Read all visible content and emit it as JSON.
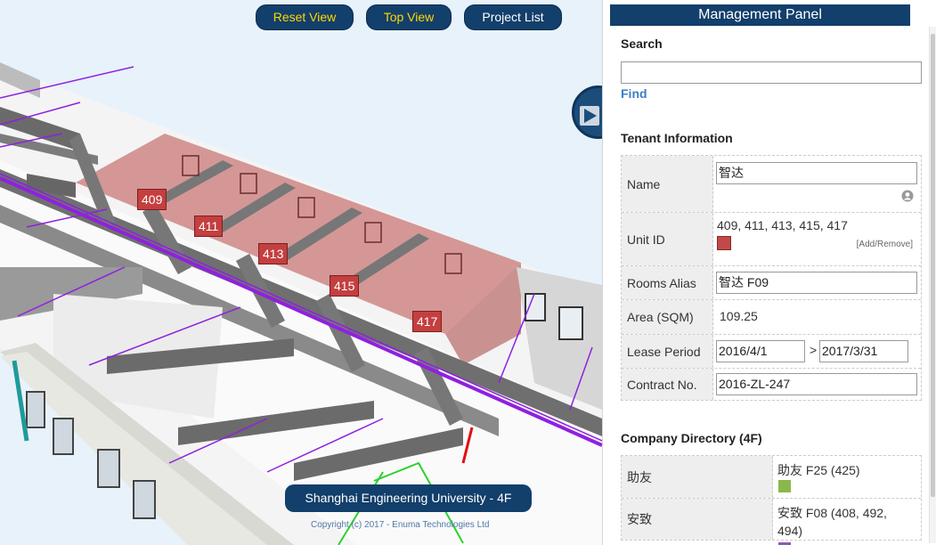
{
  "viewport": {
    "buttons": {
      "reset": "Reset View",
      "top": "Top View",
      "projects": "Project List"
    },
    "rooms": [
      "409",
      "411",
      "413",
      "415",
      "417"
    ],
    "caption": "Shanghai Engineering University - 4F",
    "copyright": "Copyright (c) 2017 - Enuma Technologies Ltd"
  },
  "panel": {
    "title": "Management Panel",
    "search": {
      "title": "Search",
      "value": "",
      "find_label": "Find"
    },
    "tenant": {
      "title": "Tenant Information",
      "name_label": "Name",
      "name_value": "智达",
      "unit_label": "Unit ID",
      "unit_value": "409, 411, 413, 415, 417",
      "unit_color": "#c04a4a",
      "add_remove": "[Add/Remove]",
      "alias_label": "Rooms Alias",
      "alias_value": "智达 F09",
      "area_label": "Area (SQM)",
      "area_value": "109.25",
      "lease_label": "Lease Period",
      "lease_start": "2016/4/1",
      "lease_sep": ">",
      "lease_end": "2017/3/31",
      "contract_label": "Contract No.",
      "contract_value": "2016-ZL-247"
    },
    "directory": {
      "title": "Company Directory (4F)",
      "companies": [
        {
          "name": "助友",
          "info": "助友 F25 (425)",
          "color": "#8ab84a"
        },
        {
          "name": "安致",
          "info": "安致 F08 (408, 492, 494)",
          "color": "#8a5bb0"
        }
      ]
    }
  }
}
